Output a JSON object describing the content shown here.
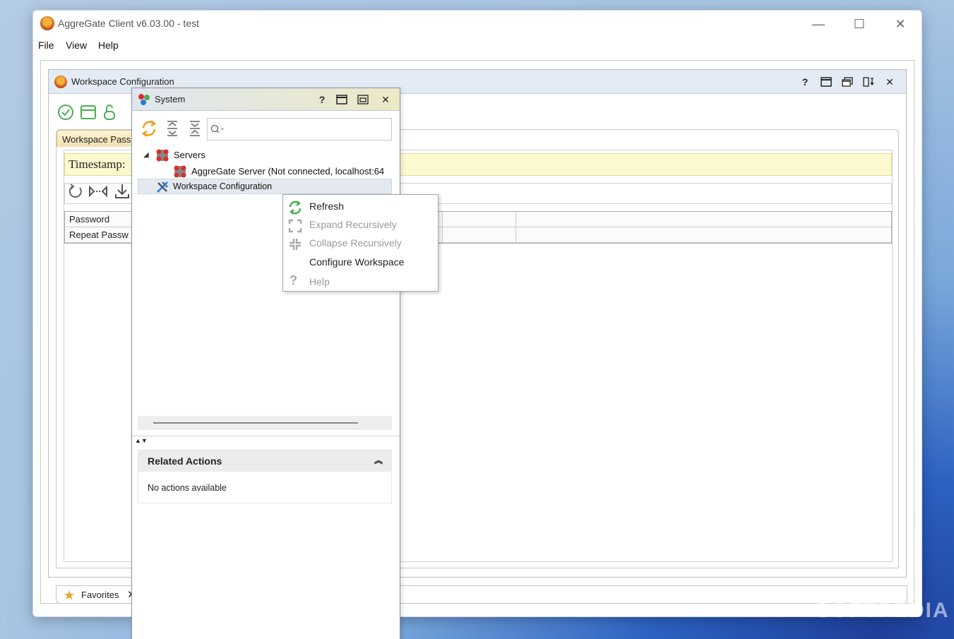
{
  "window": {
    "title": "AggreGate Client v6.03.00 - test",
    "controls": {
      "minimize": "—",
      "maximize": "☐",
      "close": "✕"
    }
  },
  "menu": [
    "File",
    "View",
    "Help"
  ],
  "workspace_config": {
    "title": "Workspace Configuration",
    "tab": "Workspace Pass",
    "timestamp_label": "Timestamp:",
    "rows": [
      "Password",
      "Repeat Passw"
    ],
    "favorites": "Favorites"
  },
  "system_panel": {
    "title": "System",
    "tree": {
      "servers": "Servers",
      "server": "AggreGate Server (Not connected, localhost:64",
      "workspace": "Workspace Configuration"
    },
    "related_actions": {
      "title": "Related Actions",
      "empty": "No actions available"
    }
  },
  "context_menu": [
    {
      "label": "Refresh",
      "enabled": true,
      "icon": "refresh-icon"
    },
    {
      "label": "Expand Recursively",
      "enabled": false,
      "icon": "expand-icon"
    },
    {
      "label": "Collapse Recursively",
      "enabled": false,
      "icon": "collapse-icon"
    },
    {
      "label": "Configure Workspace",
      "enabled": true,
      "icon": "none"
    },
    {
      "label": "Help",
      "enabled": false,
      "icon": "help-icon"
    }
  ],
  "watermark": "SOFTPEDIA",
  "colors": {
    "accent_green": "#4caf50",
    "highlight_yellow": "#fcf9cf",
    "panel_title": "#e4ebf5",
    "error_red": "#d8302a"
  }
}
